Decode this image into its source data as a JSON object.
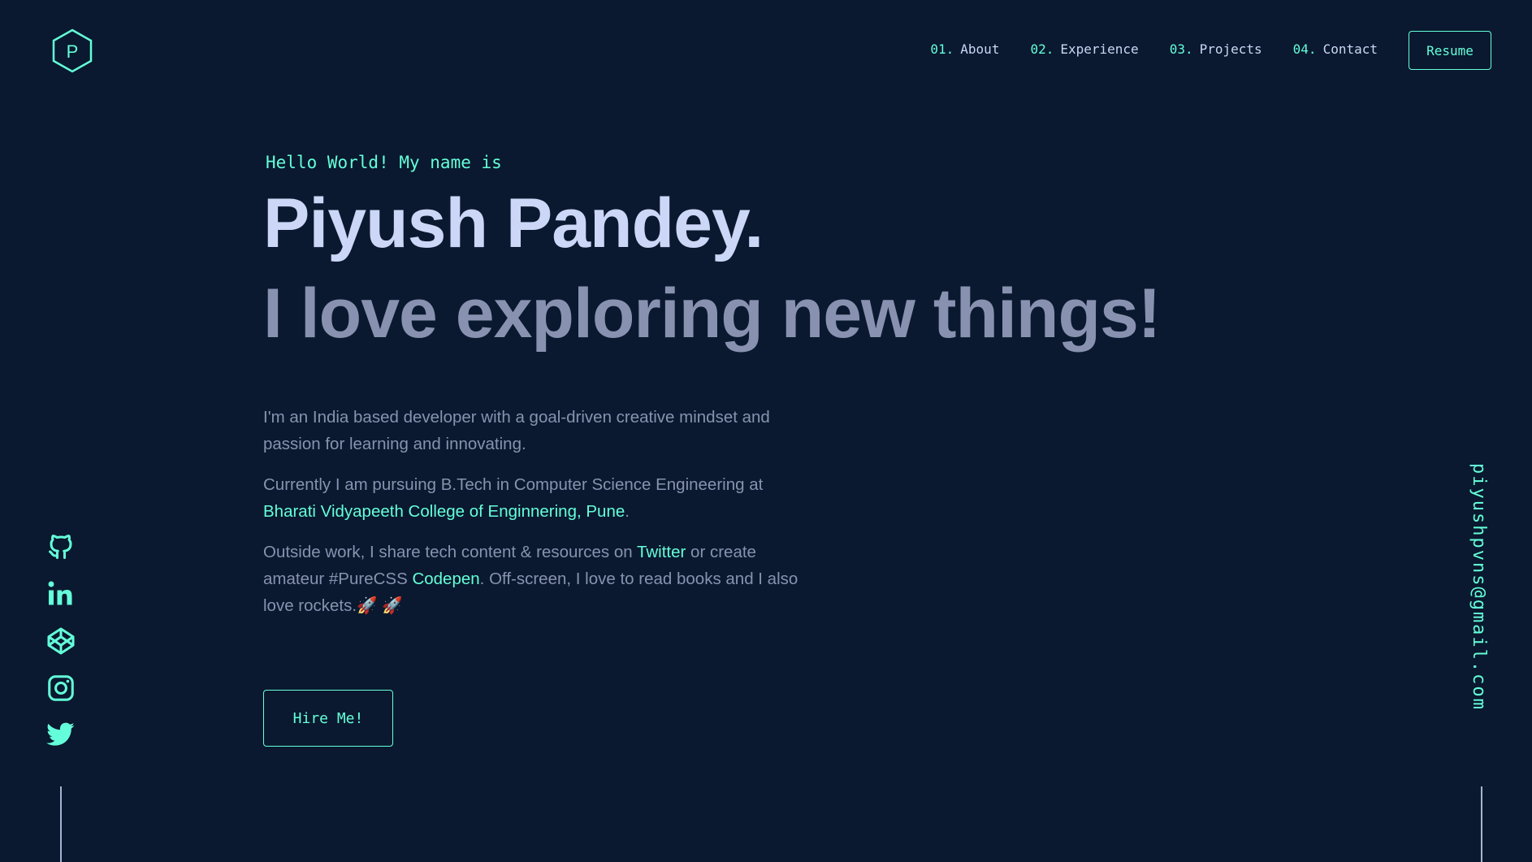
{
  "brand": {
    "logo_letter": "P"
  },
  "nav": {
    "items": [
      {
        "num": "01.",
        "label": "About"
      },
      {
        "num": "02.",
        "label": "Experience"
      },
      {
        "num": "03.",
        "label": "Projects"
      },
      {
        "num": "04.",
        "label": "Contact"
      }
    ],
    "resume_label": "Resume"
  },
  "hero": {
    "greeting": "Hello World! My name is",
    "name": "Piyush Pandey.",
    "tagline": "I love exploring new things!",
    "p1": "I'm an India based developer with a goal-driven creative mindset and passion for learning and innovating.",
    "p2_prefix": "Currently I am pursuing B.Tech in Computer Science Engineering at ",
    "p2_link": "Bharati Vidyapeeth College of Enginnering, Pune",
    "p2_suffix": ".",
    "p3_prefix": "Outside work, I share tech content & resources on ",
    "p3_link1": "Twitter",
    "p3_mid": " or create amateur #PureCSS ",
    "p3_link2": "Codepen",
    "p3_suffix": ". Off-screen, I love to read books and I also love rockets.",
    "p3_emoji": "🚀 🚀",
    "hire_label": "Hire Me!"
  },
  "socials": [
    "github-icon",
    "linkedin-icon",
    "codepen-icon",
    "instagram-icon",
    "twitter-icon"
  ],
  "email": "piyushpvns@gmail.com",
  "colors": {
    "background": "#0a192f",
    "accent": "#64ffda",
    "heading": "#ccd6f6",
    "text": "#8892b0"
  }
}
